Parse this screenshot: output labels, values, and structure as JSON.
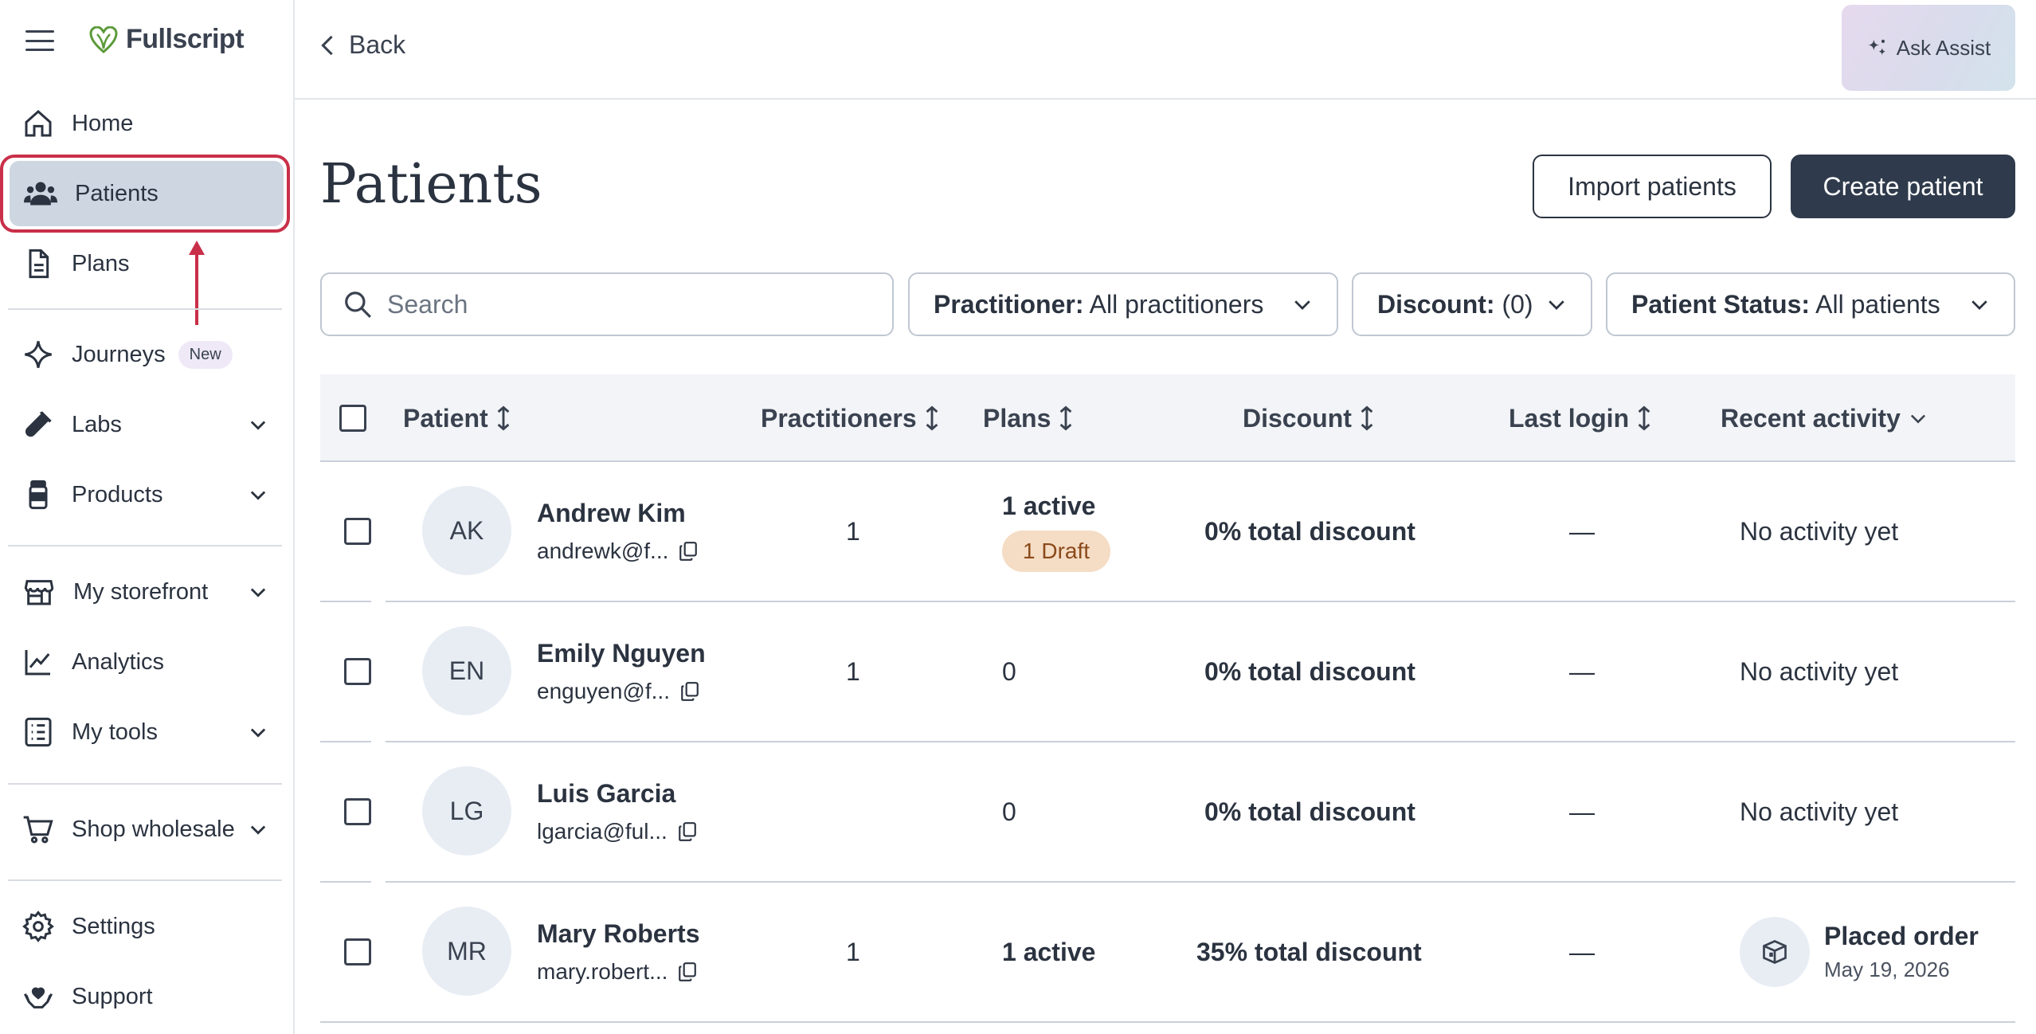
{
  "sidebar": {
    "brand": "Fullscript",
    "items": [
      {
        "label": "Home",
        "icon": "home-icon"
      },
      {
        "label": "Patients",
        "icon": "users-icon"
      },
      {
        "label": "Plans",
        "icon": "document-icon"
      },
      {
        "label": "Journeys",
        "icon": "sparkle-icon",
        "badge": "New"
      },
      {
        "label": "Labs",
        "icon": "test-tube-icon"
      },
      {
        "label": "Products",
        "icon": "bottle-icon"
      },
      {
        "label": "My storefront",
        "icon": "storefront-icon"
      },
      {
        "label": "Analytics",
        "icon": "chart-line-icon"
      },
      {
        "label": "My tools",
        "icon": "checklist-icon"
      },
      {
        "label": "Shop wholesale",
        "icon": "cart-icon"
      },
      {
        "label": "Settings",
        "icon": "gear-icon"
      },
      {
        "label": "Support",
        "icon": "heart-hands-icon"
      }
    ],
    "active": "Patients"
  },
  "header": {
    "back_label": "Back",
    "assist_label": "Ask Assist"
  },
  "page": {
    "title": "Patients",
    "import_label": "Import patients",
    "create_label": "Create patient"
  },
  "search": {
    "placeholder": "Search"
  },
  "filters": {
    "practitioner_key": "Practitioner:",
    "practitioner_value": "All practitioners",
    "discount_key": "Discount:",
    "discount_value": "(0)",
    "status_key": "Patient Status:",
    "status_value": "All patients"
  },
  "table": {
    "headers": {
      "patient": "Patient",
      "practitioners": "Practitioners",
      "plans": "Plans",
      "discount": "Discount",
      "last_login": "Last login",
      "recent_activity": "Recent activity"
    },
    "rows": [
      {
        "initials": "AK",
        "name": "Andrew Kim",
        "email": "andrewk@f...",
        "practitioners": "1",
        "plans": "1 active",
        "plans_draft": "1 Draft",
        "discount": "0% total discount",
        "last_login": "—",
        "activity": "No activity yet"
      },
      {
        "initials": "EN",
        "name": "Emily Nguyen",
        "email": "enguyen@f...",
        "practitioners": "1",
        "plans": "0",
        "discount": "0% total discount",
        "last_login": "—",
        "activity": "No activity yet"
      },
      {
        "initials": "LG",
        "name": "Luis Garcia",
        "email": "lgarcia@ful...",
        "practitioners": "",
        "plans": "0",
        "discount": "0% total discount",
        "last_login": "—",
        "activity": "No activity yet"
      },
      {
        "initials": "MR",
        "name": "Mary Roberts",
        "email": "mary.robert...",
        "practitioners": "1",
        "plans": "1 active",
        "discount": "35% total discount",
        "last_login": "—",
        "activity": "Placed order",
        "activity_date": "May 19, 2026"
      }
    ]
  },
  "colors": {
    "accent_dark": "#2f3b4c",
    "active_nav": "#cdd6e1",
    "annotation_red": "#c92f48",
    "brand_green": "#5b9a3a",
    "draft_bg": "#f5dcc4"
  }
}
